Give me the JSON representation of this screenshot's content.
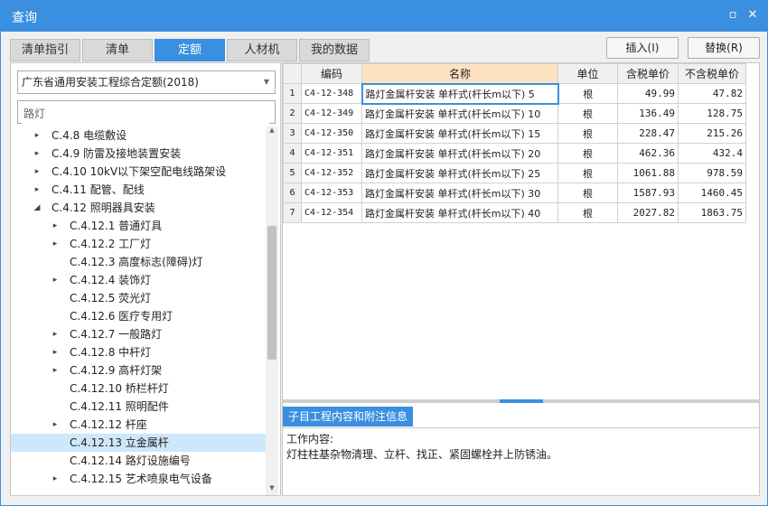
{
  "window": {
    "title": "查询"
  },
  "titlebar_icons": [
    "restore-icon",
    "close-icon"
  ],
  "tabs": [
    {
      "label": "清单指引",
      "active": false
    },
    {
      "label": "清单",
      "active": false
    },
    {
      "label": "定额",
      "active": true
    },
    {
      "label": "人材机",
      "active": false
    },
    {
      "label": "我的数据",
      "active": false
    }
  ],
  "buttons": {
    "insert": "插入(I)",
    "replace": "替换(R)"
  },
  "left": {
    "library_select": "广东省通用安装工程综合定额(2018)",
    "search_value": "路灯",
    "tree": [
      {
        "label": "C.4.8 电缆敷设",
        "level": 1,
        "toggle": "▸"
      },
      {
        "label": "C.4.9 防雷及接地装置安装",
        "level": 1,
        "toggle": "▸"
      },
      {
        "label": "C.4.10 10kV以下架空配电线路架设",
        "level": 1,
        "toggle": "▸"
      },
      {
        "label": "C.4.11 配管、配线",
        "level": 1,
        "toggle": "▸"
      },
      {
        "label": "C.4.12 照明器具安装",
        "level": 1,
        "toggle": "◢"
      },
      {
        "label": "C.4.12.1 普通灯具",
        "level": 2,
        "toggle": "▸"
      },
      {
        "label": "C.4.12.2 工厂灯",
        "level": 2,
        "toggle": "▸"
      },
      {
        "label": "C.4.12.3 高度标志(障碍)灯",
        "level": 2,
        "toggle": ""
      },
      {
        "label": "C.4.12.4 装饰灯",
        "level": 2,
        "toggle": "▸"
      },
      {
        "label": "C.4.12.5 荧光灯",
        "level": 2,
        "toggle": ""
      },
      {
        "label": "C.4.12.6 医疗专用灯",
        "level": 2,
        "toggle": ""
      },
      {
        "label": "C.4.12.7 一般路灯",
        "level": 2,
        "toggle": "▸"
      },
      {
        "label": "C.4.12.8 中杆灯",
        "level": 2,
        "toggle": "▸"
      },
      {
        "label": "C.4.12.9 高杆灯架",
        "level": 2,
        "toggle": "▸"
      },
      {
        "label": "C.4.12.10 桥栏杆灯",
        "level": 2,
        "toggle": ""
      },
      {
        "label": "C.4.12.11 照明配件",
        "level": 2,
        "toggle": ""
      },
      {
        "label": "C.4.12.12 杆座",
        "level": 2,
        "toggle": "▸"
      },
      {
        "label": "C.4.12.13 立金属杆",
        "level": 2,
        "toggle": "",
        "selected": true
      },
      {
        "label": "C.4.12.14 路灯设施编号",
        "level": 2,
        "toggle": ""
      },
      {
        "label": "C.4.12.15 艺术喷泉电气设备",
        "level": 2,
        "toggle": "▸"
      }
    ]
  },
  "table": {
    "headers": {
      "rownum": "",
      "code": "编码",
      "name": "名称",
      "unit": "单位",
      "price_tax": "含税单价",
      "price_notax": "不含税单价"
    },
    "rows": [
      {
        "n": "1",
        "code": "C4-12-348",
        "name": "路灯金属杆安装 单杆式(杆长m以下) 5",
        "unit": "根",
        "price_tax": "49.99",
        "price_notax": "47.82"
      },
      {
        "n": "2",
        "code": "C4-12-349",
        "name": "路灯金属杆安装 单杆式(杆长m以下) 10",
        "unit": "根",
        "price_tax": "136.49",
        "price_notax": "128.75"
      },
      {
        "n": "3",
        "code": "C4-12-350",
        "name": "路灯金属杆安装 单杆式(杆长m以下) 15",
        "unit": "根",
        "price_tax": "228.47",
        "price_notax": "215.26"
      },
      {
        "n": "4",
        "code": "C4-12-351",
        "name": "路灯金属杆安装 单杆式(杆长m以下) 20",
        "unit": "根",
        "price_tax": "462.36",
        "price_notax": "432.4"
      },
      {
        "n": "5",
        "code": "C4-12-352",
        "name": "路灯金属杆安装 单杆式(杆长m以下) 25",
        "unit": "根",
        "price_tax": "1061.88",
        "price_notax": "978.59"
      },
      {
        "n": "6",
        "code": "C4-12-353",
        "name": "路灯金属杆安装 单杆式(杆长m以下) 30",
        "unit": "根",
        "price_tax": "1587.93",
        "price_notax": "1460.45"
      },
      {
        "n": "7",
        "code": "C4-12-354",
        "name": "路灯金属杆安装 单杆式(杆长m以下) 40",
        "unit": "根",
        "price_tax": "2027.82",
        "price_notax": "1863.75"
      }
    ]
  },
  "info": {
    "tab_label": "子目工程内容和附注信息",
    "line1": "工作内容:",
    "line2": "灯柱柱基杂物清理、立杆、找正、紧固螺栓并上防锈油。"
  },
  "colors": {
    "accent": "#3b8fe0",
    "name_header": "#fde2c2",
    "selected_row": "#cde7fb"
  }
}
